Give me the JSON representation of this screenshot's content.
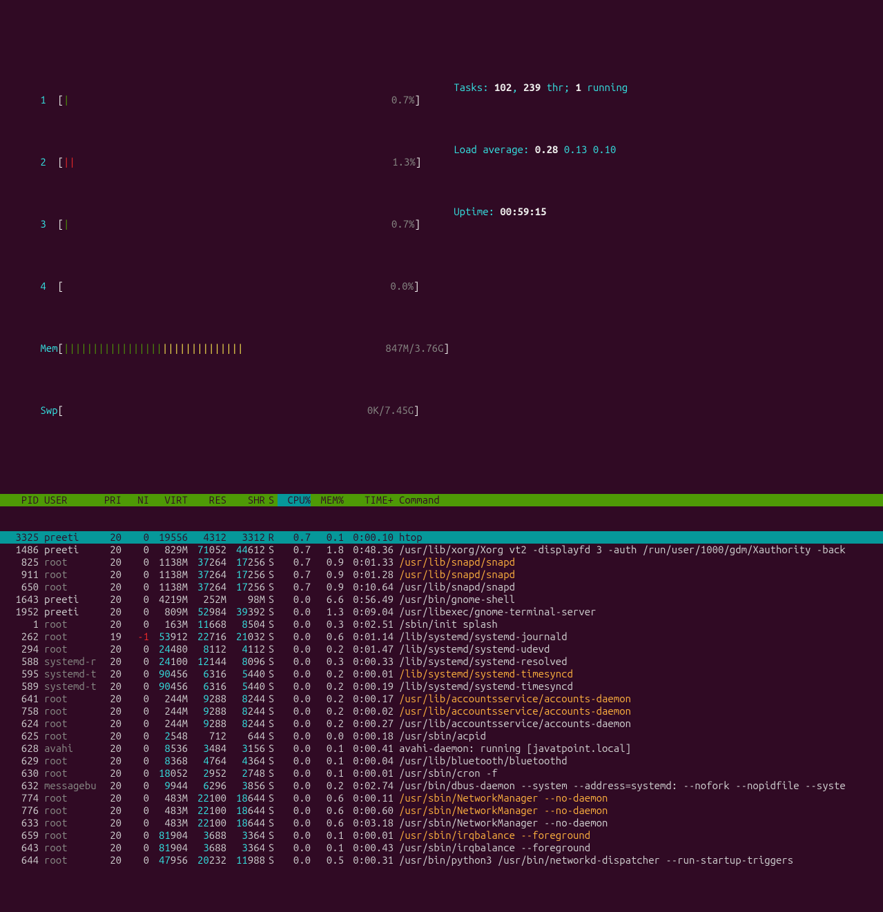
{
  "meters": {
    "cpu1": {
      "label": "1",
      "bar": "|",
      "pct": "0.7%"
    },
    "cpu2": {
      "label": "2",
      "bar": "||",
      "pct": "1.3%"
    },
    "cpu3": {
      "label": "3",
      "bar": "|",
      "pct": "0.7%"
    },
    "cpu4": {
      "label": "4",
      "bar": "",
      "pct": "0.0%"
    },
    "mem": {
      "label": "Mem",
      "bar": "|||||||||||||||||||||||||||||||",
      "pct": "847M/3.76G"
    },
    "swp": {
      "label": "Swp",
      "bar": "",
      "pct": "0K/7.45G"
    }
  },
  "summary": {
    "tasks_label": "Tasks: ",
    "tasks_n": "102",
    "tasks_comma": ", ",
    "threads": "239",
    "threads_label": " thr; ",
    "running": "1",
    "running_label": " running",
    "load_label": "Load average: ",
    "l1": "0.28",
    "l2": "0.13",
    "l3": "0.10",
    "uptime_label": "Uptime: ",
    "uptime": "00:59:15"
  },
  "header": {
    "pid": "PID",
    "user": "USER",
    "pri": "PRI",
    "ni": "NI",
    "virt": "VIRT",
    "res": "RES",
    "shr": "SHR",
    "s": "S",
    "cpu": "CPU%",
    "mem": "MEM%",
    "time": "TIME+",
    "cmd": "Command"
  },
  "rows": [
    {
      "pid": "3325",
      "user": "preeti",
      "ud": 0,
      "pri": "20",
      "ni": "0",
      "vh": "",
      "v": "19556",
      "rh": "",
      "r": "4312",
      "sh": "",
      "shv": "3312",
      "s": "R",
      "cpu": "0.7",
      "mem": "0.1",
      "time": "0:00.10",
      "cmd": "htop",
      "cc": 0,
      "sel": 1
    },
    {
      "pid": "1486",
      "user": "preeti",
      "ud": 0,
      "pri": "20",
      "ni": "0",
      "vh": "",
      "v": "829M",
      "rh": "71",
      "r": "052",
      "sh": "44",
      "shv": "612",
      "s": "S",
      "cpu": "0.7",
      "mem": "1.8",
      "time": "0:48.36",
      "cmd": "/usr/lib/xorg/Xorg vt2 -displayfd 3 -auth /run/user/1000/gdm/Xauthority -back",
      "cc": 0
    },
    {
      "pid": "825",
      "user": "root",
      "ud": 1,
      "pri": "20",
      "ni": "0",
      "vh": "",
      "v": "1138M",
      "rh": "37",
      "r": "264",
      "sh": "17",
      "shv": "256",
      "s": "S",
      "cpu": "0.7",
      "mem": "0.9",
      "time": "0:01.33",
      "cmd": "/usr/lib/snapd/snapd",
      "cc": 1
    },
    {
      "pid": "911",
      "user": "root",
      "ud": 1,
      "pri": "20",
      "ni": "0",
      "vh": "",
      "v": "1138M",
      "rh": "37",
      "r": "264",
      "sh": "17",
      "shv": "256",
      "s": "S",
      "cpu": "0.7",
      "mem": "0.9",
      "time": "0:01.28",
      "cmd": "/usr/lib/snapd/snapd",
      "cc": 1
    },
    {
      "pid": "650",
      "user": "root",
      "ud": 1,
      "pri": "20",
      "ni": "0",
      "vh": "",
      "v": "1138M",
      "rh": "37",
      "r": "264",
      "sh": "17",
      "shv": "256",
      "s": "S",
      "cpu": "0.7",
      "mem": "0.9",
      "time": "0:10.64",
      "cmd": "/usr/lib/snapd/snapd",
      "cc": 0
    },
    {
      "pid": "1643",
      "user": "preeti",
      "ud": 0,
      "pri": "20",
      "ni": "0",
      "vh": "",
      "v": "4219M",
      "rh": "",
      "r": "252M",
      "sh": "",
      "shv": "98M",
      "s": "S",
      "cpu": "0.0",
      "mem": "6.6",
      "time": "0:56.49",
      "cmd": "/usr/bin/gnome-shell",
      "cc": 0
    },
    {
      "pid": "1952",
      "user": "preeti",
      "ud": 0,
      "pri": "20",
      "ni": "0",
      "vh": "",
      "v": "809M",
      "rh": "52",
      "r": "984",
      "sh": "39",
      "shv": "392",
      "s": "S",
      "cpu": "0.0",
      "mem": "1.3",
      "time": "0:09.04",
      "cmd": "/usr/libexec/gnome-terminal-server",
      "cc": 0
    },
    {
      "pid": "1",
      "user": "root",
      "ud": 1,
      "pri": "20",
      "ni": "0",
      "vh": "",
      "v": "163M",
      "rh": "11",
      "r": "668",
      "sh": "8",
      "shv": "504",
      "s": "S",
      "cpu": "0.0",
      "mem": "0.3",
      "time": "0:02.51",
      "cmd": "/sbin/init splash",
      "cc": 0
    },
    {
      "pid": "262",
      "user": "root",
      "ud": 1,
      "pri": "19",
      "ni": "-1",
      "nir": 1,
      "vh": "53",
      "v": "912",
      "rh": "22",
      "r": "716",
      "sh": "21",
      "shv": "032",
      "s": "S",
      "cpu": "0.0",
      "mem": "0.6",
      "time": "0:01.14",
      "cmd": "/lib/systemd/systemd-journald",
      "cc": 0
    },
    {
      "pid": "294",
      "user": "root",
      "ud": 1,
      "pri": "20",
      "ni": "0",
      "vh": "24",
      "v": "480",
      "rh": "8",
      "r": "112",
      "sh": "4",
      "shv": "112",
      "s": "S",
      "cpu": "0.0",
      "mem": "0.2",
      "time": "0:01.47",
      "cmd": "/lib/systemd/systemd-udevd",
      "cc": 0
    },
    {
      "pid": "588",
      "user": "systemd-r",
      "ud": 1,
      "pri": "20",
      "ni": "0",
      "vh": "24",
      "v": "100",
      "rh": "12",
      "r": "144",
      "sh": "8",
      "shv": "096",
      "s": "S",
      "cpu": "0.0",
      "mem": "0.3",
      "time": "0:00.33",
      "cmd": "/lib/systemd/systemd-resolved",
      "cc": 0
    },
    {
      "pid": "595",
      "user": "systemd-t",
      "ud": 1,
      "pri": "20",
      "ni": "0",
      "vh": "90",
      "v": "456",
      "rh": "6",
      "r": "316",
      "sh": "5",
      "shv": "440",
      "s": "S",
      "cpu": "0.0",
      "mem": "0.2",
      "time": "0:00.01",
      "cmd": "/lib/systemd/systemd-timesyncd",
      "cc": 1
    },
    {
      "pid": "589",
      "user": "systemd-t",
      "ud": 1,
      "pri": "20",
      "ni": "0",
      "vh": "90",
      "v": "456",
      "rh": "6",
      "r": "316",
      "sh": "5",
      "shv": "440",
      "s": "S",
      "cpu": "0.0",
      "mem": "0.2",
      "time": "0:00.19",
      "cmd": "/lib/systemd/systemd-timesyncd",
      "cc": 0
    },
    {
      "pid": "641",
      "user": "root",
      "ud": 1,
      "pri": "20",
      "ni": "0",
      "vh": "",
      "v": "244M",
      "rh": "9",
      "r": "288",
      "sh": "8",
      "shv": "244",
      "s": "S",
      "cpu": "0.0",
      "mem": "0.2",
      "time": "0:00.17",
      "cmd": "/usr/lib/accountsservice/accounts-daemon",
      "cc": 1
    },
    {
      "pid": "758",
      "user": "root",
      "ud": 1,
      "pri": "20",
      "ni": "0",
      "vh": "",
      "v": "244M",
      "rh": "9",
      "r": "288",
      "sh": "8",
      "shv": "244",
      "s": "S",
      "cpu": "0.0",
      "mem": "0.2",
      "time": "0:00.02",
      "cmd": "/usr/lib/accountsservice/accounts-daemon",
      "cc": 1
    },
    {
      "pid": "624",
      "user": "root",
      "ud": 1,
      "pri": "20",
      "ni": "0",
      "vh": "",
      "v": "244M",
      "rh": "9",
      "r": "288",
      "sh": "8",
      "shv": "244",
      "s": "S",
      "cpu": "0.0",
      "mem": "0.2",
      "time": "0:00.27",
      "cmd": "/usr/lib/accountsservice/accounts-daemon",
      "cc": 0
    },
    {
      "pid": "625",
      "user": "root",
      "ud": 1,
      "pri": "20",
      "ni": "0",
      "vh": "2",
      "v": "548",
      "rh": "",
      "r": "712",
      "sh": "",
      "shv": "644",
      "s": "S",
      "cpu": "0.0",
      "mem": "0.0",
      "time": "0:00.18",
      "cmd": "/usr/sbin/acpid",
      "cc": 0
    },
    {
      "pid": "628",
      "user": "avahi",
      "ud": 1,
      "pri": "20",
      "ni": "0",
      "vh": "8",
      "v": "536",
      "rh": "3",
      "r": "484",
      "sh": "3",
      "shv": "156",
      "s": "S",
      "cpu": "0.0",
      "mem": "0.1",
      "time": "0:00.41",
      "cmd": "avahi-daemon: running [javatpoint.local]",
      "cc": 0
    },
    {
      "pid": "629",
      "user": "root",
      "ud": 1,
      "pri": "20",
      "ni": "0",
      "vh": "8",
      "v": "368",
      "rh": "4",
      "r": "764",
      "sh": "4",
      "shv": "364",
      "s": "S",
      "cpu": "0.0",
      "mem": "0.1",
      "time": "0:00.04",
      "cmd": "/usr/lib/bluetooth/bluetoothd",
      "cc": 0
    },
    {
      "pid": "630",
      "user": "root",
      "ud": 1,
      "pri": "20",
      "ni": "0",
      "vh": "18",
      "v": "052",
      "rh": "2",
      "r": "952",
      "sh": "2",
      "shv": "748",
      "s": "S",
      "cpu": "0.0",
      "mem": "0.1",
      "time": "0:00.01",
      "cmd": "/usr/sbin/cron -f",
      "cc": 0
    },
    {
      "pid": "632",
      "user": "messagebu",
      "ud": 1,
      "pri": "20",
      "ni": "0",
      "vh": "9",
      "v": "944",
      "rh": "6",
      "r": "296",
      "sh": "3",
      "shv": "856",
      "s": "S",
      "cpu": "0.0",
      "mem": "0.2",
      "time": "0:02.74",
      "cmd": "/usr/bin/dbus-daemon --system --address=systemd: --nofork --nopidfile --syste",
      "cc": 0
    },
    {
      "pid": "774",
      "user": "root",
      "ud": 1,
      "pri": "20",
      "ni": "0",
      "vh": "",
      "v": "483M",
      "rh": "22",
      "r": "100",
      "sh": "18",
      "shv": "644",
      "s": "S",
      "cpu": "0.0",
      "mem": "0.6",
      "time": "0:00.11",
      "cmd": "/usr/sbin/NetworkManager --no-daemon",
      "cc": 1
    },
    {
      "pid": "776",
      "user": "root",
      "ud": 1,
      "pri": "20",
      "ni": "0",
      "vh": "",
      "v": "483M",
      "rh": "22",
      "r": "100",
      "sh": "18",
      "shv": "644",
      "s": "S",
      "cpu": "0.0",
      "mem": "0.6",
      "time": "0:00.60",
      "cmd": "/usr/sbin/NetworkManager --no-daemon",
      "cc": 1
    },
    {
      "pid": "633",
      "user": "root",
      "ud": 1,
      "pri": "20",
      "ni": "0",
      "vh": "",
      "v": "483M",
      "rh": "22",
      "r": "100",
      "sh": "18",
      "shv": "644",
      "s": "S",
      "cpu": "0.0",
      "mem": "0.6",
      "time": "0:03.18",
      "cmd": "/usr/sbin/NetworkManager --no-daemon",
      "cc": 0
    },
    {
      "pid": "659",
      "user": "root",
      "ud": 1,
      "pri": "20",
      "ni": "0",
      "vh": "81",
      "v": "904",
      "rh": "3",
      "r": "688",
      "sh": "3",
      "shv": "364",
      "s": "S",
      "cpu": "0.0",
      "mem": "0.1",
      "time": "0:00.01",
      "cmd": "/usr/sbin/irqbalance --foreground",
      "cc": 1
    },
    {
      "pid": "643",
      "user": "root",
      "ud": 1,
      "pri": "20",
      "ni": "0",
      "vh": "81",
      "v": "904",
      "rh": "3",
      "r": "688",
      "sh": "3",
      "shv": "364",
      "s": "S",
      "cpu": "0.0",
      "mem": "0.1",
      "time": "0:00.43",
      "cmd": "/usr/sbin/irqbalance --foreground",
      "cc": 0
    },
    {
      "pid": "644",
      "user": "root",
      "ud": 1,
      "pri": "20",
      "ni": "0",
      "vh": "47",
      "v": "956",
      "rh": "20",
      "r": "232",
      "sh": "11",
      "shv": "988",
      "s": "S",
      "cpu": "0.0",
      "mem": "0.5",
      "time": "0:00.31",
      "cmd": "/usr/bin/python3 /usr/bin/networkd-dispatcher --run-startup-triggers",
      "cc": 0
    }
  ]
}
